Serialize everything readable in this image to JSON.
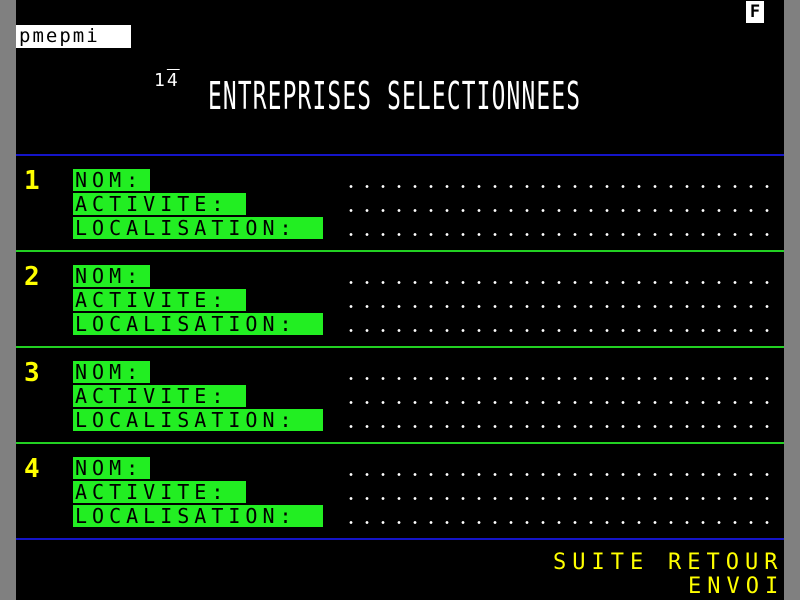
{
  "header": {
    "status_indicator": "F",
    "service_name": "pmepmi",
    "page_number_prefix": "1",
    "page_number_overbar": "4",
    "title": "ENTREPRISES SELECTIONNEES"
  },
  "entries": [
    {
      "number": "1",
      "labels": {
        "nom": "NOM:",
        "activite": "ACTIVITE:",
        "localisation": "LOCALISATION:"
      }
    },
    {
      "number": "2",
      "labels": {
        "nom": "NOM:",
        "activite": "ACTIVITE:",
        "localisation": "LOCALISATION:"
      }
    },
    {
      "number": "3",
      "labels": {
        "nom": "NOM:",
        "activite": "ACTIVITE:",
        "localisation": "LOCALISATION:"
      }
    },
    {
      "number": "4",
      "labels": {
        "nom": "NOM:",
        "activite": "ACTIVITE:",
        "localisation": "LOCALISATION:"
      }
    }
  ],
  "footer": {
    "suite": "SUITE",
    "retour": "RETOUR",
    "envoi": "ENVOI"
  },
  "colors": {
    "background": "#000000",
    "label_bg": "#22ee22",
    "separator_green": "#22d022",
    "separator_blue": "#1414c8",
    "accent_yellow": "#ffff00",
    "text_white": "#ffffff"
  }
}
